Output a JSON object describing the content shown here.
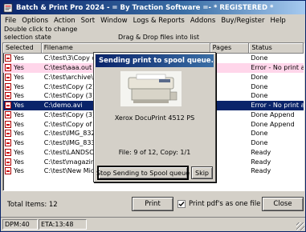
{
  "window": {
    "title": "Batch & Print Pro 2024 - = By Traction Software =- * REGISTERED *"
  },
  "menu": [
    "File",
    "Options",
    "Action",
    "Sort",
    "Window",
    "Logs & Reports",
    "Addons",
    "Buy/Register",
    "Help"
  ],
  "hint": {
    "line1": "Double click to change",
    "line2": "selection state",
    "dragdrop": "Drag & Drop files into list"
  },
  "table": {
    "headers": [
      "Selected",
      "Filename",
      "Pages",
      "Status"
    ],
    "rows": [
      {
        "selected": "Yes",
        "filename": "C:\\test\\3\\Copy of",
        "pages": "",
        "status": "Done",
        "highlight": ""
      },
      {
        "selected": "Yes",
        "filename": "C:\\test\\aaa.out",
        "pages": "",
        "status": "Error - No print association",
        "highlight": "pink"
      },
      {
        "selected": "Yes",
        "filename": "C:\\test\\archive\\Ne",
        "pages": "",
        "status": "Done",
        "highlight": ""
      },
      {
        "selected": "Yes",
        "filename": "C:\\test\\Copy (2) of",
        "pages": "",
        "status": "Done",
        "highlight": ""
      },
      {
        "selected": "Yes",
        "filename": "C:\\test\\Copy (3) of",
        "pages": "",
        "status": "Done",
        "highlight": ""
      },
      {
        "selected": "Yes",
        "filename": "C:\\demo.avi",
        "pages": "",
        "status": "Error - No print association",
        "highlight": "blue"
      },
      {
        "selected": "Yes",
        "filename": "C:\\test\\Copy (3) of",
        "pages": "",
        "status": "Done Append",
        "highlight": ""
      },
      {
        "selected": "Yes",
        "filename": "C:\\test\\Copy of m",
        "pages": "",
        "status": "Done Append",
        "highlight": ""
      },
      {
        "selected": "Yes",
        "filename": "C:\\test\\IMG_8329",
        "pages": "",
        "status": "Done",
        "highlight": ""
      },
      {
        "selected": "Yes",
        "filename": "C:\\test\\IMG_8330",
        "pages": "",
        "status": "Done",
        "highlight": ""
      },
      {
        "selected": "Yes",
        "filename": "C:\\test\\LANDSCA",
        "pages": "",
        "status": "Ready",
        "highlight": ""
      },
      {
        "selected": "Yes",
        "filename": "C:\\test\\magazine-",
        "pages": "",
        "status": "Ready",
        "highlight": ""
      },
      {
        "selected": "Yes",
        "filename": "C:\\test\\New Micro",
        "pages": "",
        "status": "Ready",
        "highlight": ""
      }
    ]
  },
  "dialog": {
    "title": "Sending print to spool queue...",
    "printer_name": "Xerox DocuPrint 4512 PS",
    "progress": "File: 9 of 12, Copy: 1/1",
    "stop_label": "Stop Sending to Spool queue",
    "skip_label": "Skip"
  },
  "footer": {
    "total_label": "Total Items:  12",
    "print_label": "Print",
    "checkbox_label": "Print pdf's as one file",
    "checkbox_checked": true,
    "close_label": "Close"
  },
  "statusbar": {
    "dpm": "DPM:40",
    "eta": "ETA:13:48"
  },
  "colors": {
    "title_gradient_start": "#0a246a",
    "selected_row": "#0a246a",
    "error_row": "#ffd6ea",
    "face": "#d4d0c8"
  }
}
